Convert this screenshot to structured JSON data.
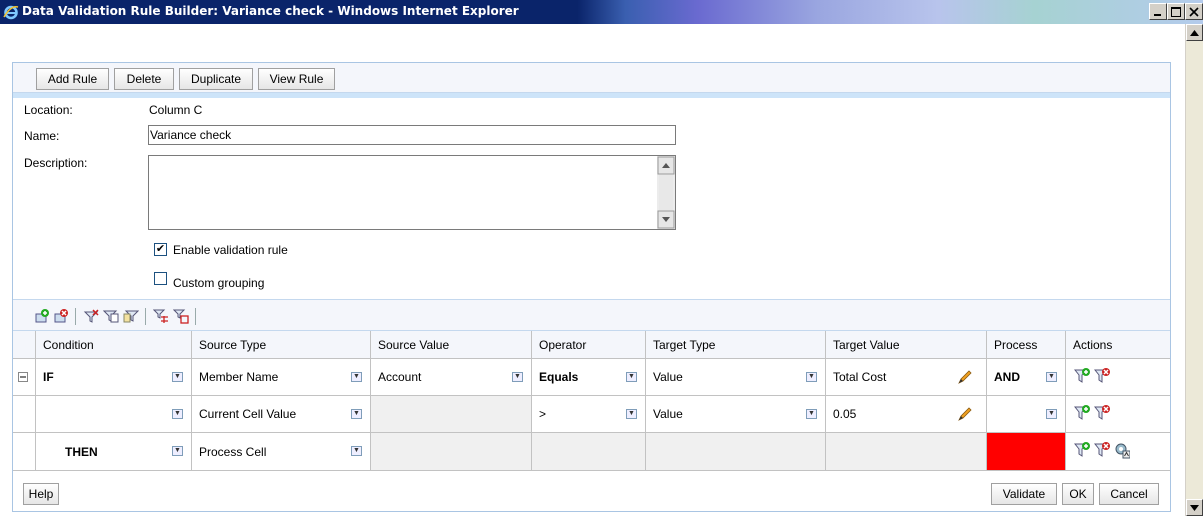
{
  "window": {
    "title": "Data Validation Rule Builder: Variance check - Windows Internet Explorer"
  },
  "toolbar": {
    "add_rule": "Add Rule",
    "delete": "Delete",
    "duplicate": "Duplicate",
    "view_rule": "View Rule"
  },
  "form": {
    "location_label": "Location:",
    "location_value": "Column C",
    "name_label": "Name:",
    "name_value": "Variance check",
    "description_label": "Description:",
    "description_value": "",
    "enable_label": "Enable validation rule",
    "enable_checked": true,
    "custom_grouping_label": "Custom grouping",
    "custom_grouping_checked": false
  },
  "grid": {
    "headers": [
      "Condition",
      "Source Type",
      "Source Value",
      "Operator",
      "Target Type",
      "Target Value",
      "Process",
      "Actions"
    ],
    "rows": [
      {
        "condition": "IF",
        "source_type": "Member Name",
        "source_value": "Account",
        "operator": "Equals",
        "target_type": "Value",
        "target_value": "Total Cost",
        "process": "AND"
      },
      {
        "condition": "",
        "source_type": "Current Cell Value",
        "source_value": "",
        "operator": ">",
        "target_type": "Value",
        "target_value": "0.05",
        "process": ""
      },
      {
        "condition": "THEN",
        "source_type": "Process Cell",
        "source_value": "",
        "operator": "",
        "target_type": "",
        "target_value": "",
        "process": ""
      }
    ],
    "process_cell_color": "#ff0000"
  },
  "footer": {
    "help": "Help",
    "validate": "Validate",
    "ok": "OK",
    "cancel": "Cancel"
  },
  "icons": {
    "title": "ie-logo-icon",
    "actions": [
      "add-condition-icon",
      "delete-condition-icon",
      "process-cell-settings-icon"
    ]
  },
  "colors": {
    "titlebar": "#0a246a",
    "accent_band": "#cde4f9",
    "process_fill": "#ff0000"
  }
}
